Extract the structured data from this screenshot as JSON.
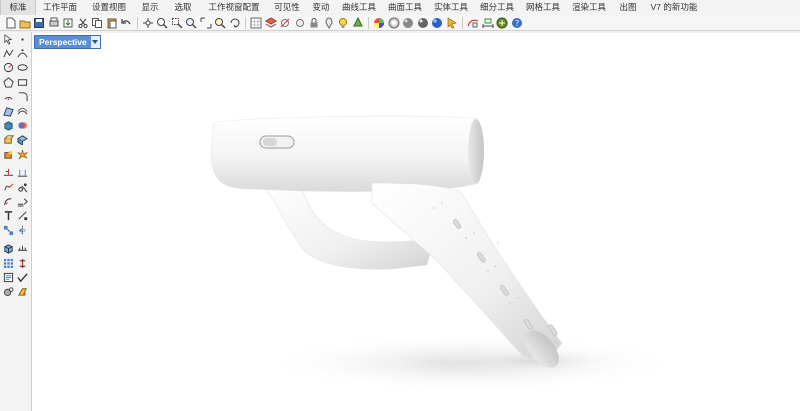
{
  "menu_tabs": [
    {
      "label": "标准",
      "active": true
    },
    {
      "label": "工作平面",
      "active": false
    },
    {
      "label": "设置视图",
      "active": false
    },
    {
      "label": "显示",
      "active": false
    },
    {
      "label": "选取",
      "active": false
    },
    {
      "label": "工作视窗配置",
      "active": false
    },
    {
      "label": "可见性",
      "active": false
    },
    {
      "label": "变动",
      "active": false
    },
    {
      "label": "曲线工具",
      "active": false
    },
    {
      "label": "曲面工具",
      "active": false
    },
    {
      "label": "实体工具",
      "active": false
    },
    {
      "label": "细分工具",
      "active": false
    },
    {
      "label": "网格工具",
      "active": false
    },
    {
      "label": "渲染工具",
      "active": false
    },
    {
      "label": "出图",
      "active": false
    },
    {
      "label": "V7 的新功能",
      "active": false
    }
  ],
  "toolbar_icons": [
    "new-file",
    "open-file",
    "save-file",
    "print",
    "import",
    "cut",
    "copy",
    "paste",
    "undo",
    "pan",
    "zoom-in",
    "zoom-window",
    "zoom-extents",
    "zoom-selected",
    "zoom-target",
    "rotate-view",
    "grid-snap",
    "layer",
    "hide",
    "show",
    "lock",
    "unlock",
    "light",
    "material",
    "color-wheel",
    "render-preview",
    "shaded",
    "rendered",
    "sphere",
    "pointer",
    "curve-tool",
    "dimension",
    "plugin",
    "help"
  ],
  "left_tools": [
    [
      "select-arrow",
      "point"
    ],
    [
      "polyline",
      "curve-control"
    ],
    [
      "circle",
      "ellipse"
    ],
    [
      "polygon",
      "rectangle"
    ],
    [
      "arc",
      "fillet-curve"
    ],
    [
      "surface-corner",
      "surface-loft"
    ],
    [
      "box-solid",
      "boolean"
    ],
    [
      "extrude",
      "cage-edit"
    ],
    [
      "solid-tools",
      "explode"
    ],
    [
      "split",
      "trim"
    ],
    [
      "join",
      "group"
    ],
    [
      "fillet",
      "offset"
    ],
    [
      "text",
      "dimension-tool"
    ],
    [
      "array",
      "mirror"
    ],
    [
      "mesh",
      "snap-grid"
    ],
    [
      "grid-array",
      "layout"
    ],
    [
      "properties",
      "check"
    ],
    [
      "render",
      "paint"
    ]
  ],
  "viewport": {
    "title": "Perspective"
  },
  "colors": {
    "viewport_tab_bg": "#5b8fd4",
    "viewport_bg": "#ffffff",
    "model_light": "#fafafa",
    "model_shadow": "#c9c9c9"
  }
}
